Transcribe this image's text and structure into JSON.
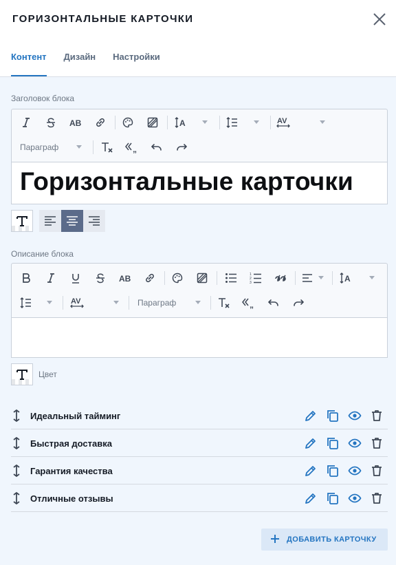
{
  "panel": {
    "title": "ГОРИЗОНТАЛЬНЫЕ КАРТОЧКИ"
  },
  "tabs": [
    {
      "label": "Контент",
      "active": true
    },
    {
      "label": "Дизайн",
      "active": false
    },
    {
      "label": "Настройки",
      "active": false
    }
  ],
  "heading_editor": {
    "label": "Заголовок блока",
    "paragraph_select": "Параграф",
    "content": "Горизонтальные карточки",
    "alignment": "center"
  },
  "description_editor": {
    "label": "Описание блока",
    "paragraph_select": "Параграф",
    "content": "",
    "color_label": "Цвет"
  },
  "cards": [
    {
      "name": "Идеальный тайминг"
    },
    {
      "name": "Быстрая доставка"
    },
    {
      "name": "Гарантия качества"
    },
    {
      "name": "Отличные отзывы"
    }
  ],
  "add_button": {
    "label": "ДОБАВИТЬ КАРТОЧКУ"
  },
  "colors": {
    "accent": "#2475c1",
    "background": "#f0f6fd",
    "active_align": "#5b6b8a"
  }
}
